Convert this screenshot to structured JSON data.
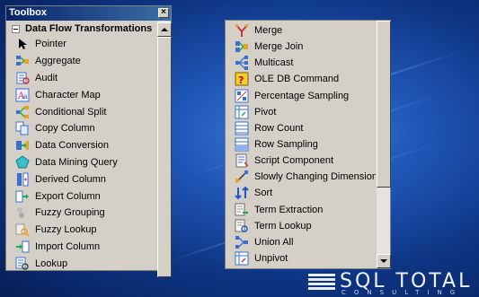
{
  "window": {
    "title": "Toolbox"
  },
  "group": {
    "label": "Data Flow Transformations"
  },
  "toolbox_items": [
    {
      "label": "Pointer",
      "icon": "pointer-icon"
    },
    {
      "label": "Aggregate",
      "icon": "aggregate-icon"
    },
    {
      "label": "Audit",
      "icon": "audit-icon"
    },
    {
      "label": "Character Map",
      "icon": "character-map-icon"
    },
    {
      "label": "Conditional Split",
      "icon": "conditional-split-icon"
    },
    {
      "label": "Copy Column",
      "icon": "copy-column-icon"
    },
    {
      "label": "Data Conversion",
      "icon": "data-conversion-icon"
    },
    {
      "label": "Data Mining Query",
      "icon": "data-mining-query-icon"
    },
    {
      "label": "Derived Column",
      "icon": "derived-column-icon"
    },
    {
      "label": "Export Column",
      "icon": "export-column-icon"
    },
    {
      "label": "Fuzzy Grouping",
      "icon": "fuzzy-grouping-icon"
    },
    {
      "label": "Fuzzy Lookup",
      "icon": "fuzzy-lookup-icon"
    },
    {
      "label": "Import Column",
      "icon": "import-column-icon"
    },
    {
      "label": "Lookup",
      "icon": "lookup-icon"
    }
  ],
  "panel2_items": [
    {
      "label": "Merge",
      "icon": "merge-icon"
    },
    {
      "label": "Merge Join",
      "icon": "merge-join-icon"
    },
    {
      "label": "Multicast",
      "icon": "multicast-icon"
    },
    {
      "label": "OLE DB Command",
      "icon": "ole-db-command-icon"
    },
    {
      "label": "Percentage Sampling",
      "icon": "percentage-sampling-icon"
    },
    {
      "label": "Pivot",
      "icon": "pivot-icon"
    },
    {
      "label": "Row Count",
      "icon": "row-count-icon"
    },
    {
      "label": "Row Sampling",
      "icon": "row-sampling-icon"
    },
    {
      "label": "Script Component",
      "icon": "script-component-icon"
    },
    {
      "label": "Slowly Changing Dimension",
      "icon": "slowly-changing-dimension-icon"
    },
    {
      "label": "Sort",
      "icon": "sort-icon"
    },
    {
      "label": "Term Extraction",
      "icon": "term-extraction-icon"
    },
    {
      "label": "Term Lookup",
      "icon": "term-lookup-icon"
    },
    {
      "label": "Union All",
      "icon": "union-all-icon"
    },
    {
      "label": "Unpivot",
      "icon": "unpivot-icon"
    }
  ],
  "logo": {
    "name": "SQL TOTAL",
    "sub": "CONSULTING"
  }
}
